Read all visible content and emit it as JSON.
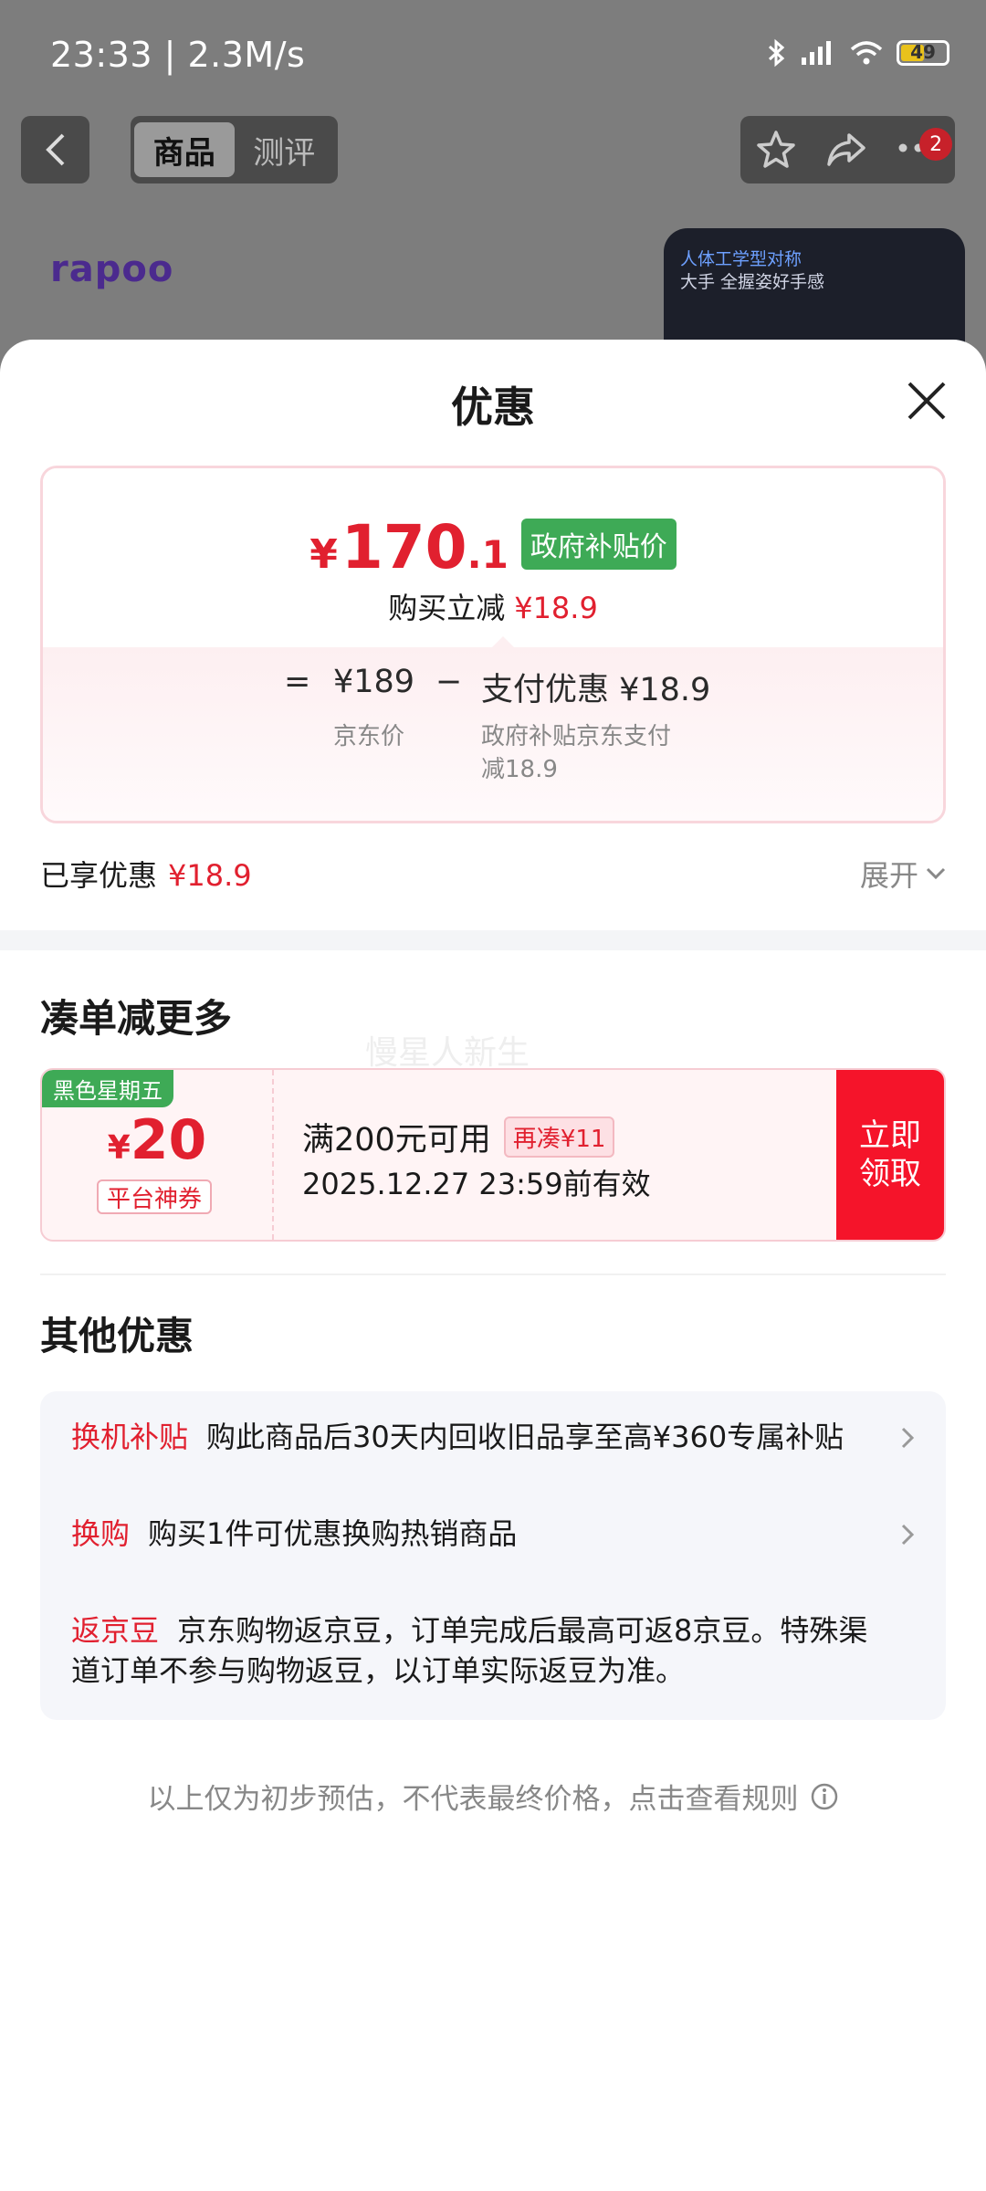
{
  "status_bar": {
    "time": "23:33 | 2.3M/s",
    "battery": "49"
  },
  "top_nav": {
    "tabs": [
      "商品",
      "测评"
    ],
    "cart_badge": "2"
  },
  "product_bg": {
    "brand": "rapoo",
    "promo_line1": "人体工学型对称",
    "promo_line2": "大手 全握姿好手感"
  },
  "sheet": {
    "title": "优惠",
    "price": {
      "symbol": "¥",
      "integer": "170",
      "decimal": ".1",
      "tag": "政府补贴价",
      "instant_label": "购买立减",
      "instant_value": "¥18.9"
    },
    "calc": {
      "eq": "=",
      "base_price": "¥189",
      "base_label": "京东价",
      "minus": "−",
      "discount": "支付优惠 ¥18.9",
      "discount_desc_1": "政府补贴京东支付",
      "discount_desc_2": "减18.9"
    },
    "enjoyed": {
      "label": "已享优惠",
      "value": "¥18.9",
      "expand": "展开"
    },
    "combine": {
      "heading": "凑单减更多",
      "watermark": "慢星人新生",
      "coupon": {
        "tag": "黑色星期五",
        "symbol": "¥",
        "amount": "20",
        "type": "平台神券",
        "condition": "满200元可用",
        "more": "再凑¥11",
        "valid": "2025.12.27 23:59前有效",
        "claim_1": "立即",
        "claim_2": "领取"
      }
    },
    "other": {
      "heading": "其他优惠",
      "items": [
        {
          "label": "换机补贴",
          "text": "购此商品后30天内回收旧品享至高¥360专属补贴"
        },
        {
          "label": "换购",
          "text": "购买1件可优惠换购热销商品"
        },
        {
          "label": "返京豆",
          "text": "京东购物返京豆，订单完成后最高可返8京豆。特殊渠道订单不参与购物返豆，以订单实际返豆为准。"
        }
      ]
    },
    "disclaimer": "以上仅为初步预估，不代表最终价格，点击查看规则"
  },
  "colors": {
    "accent_red": "#e1202f",
    "gov_green": "#3eaa56",
    "claim_red": "#f5142a"
  }
}
